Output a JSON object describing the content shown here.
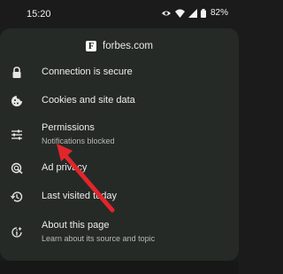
{
  "statusbar": {
    "time": "15:20",
    "icons": [
      "eye-icon",
      "wifi-icon",
      "signal-icon",
      "battery-icon"
    ],
    "battery": "82%"
  },
  "header": {
    "favicon_letter": "F",
    "site": "forbes.com"
  },
  "menu": {
    "items": [
      {
        "icon": "lock-icon",
        "title": "Connection is secure"
      },
      {
        "icon": "cookie-icon",
        "title": "Cookies and site data"
      },
      {
        "icon": "tune-icon",
        "title": "Permissions",
        "subtitle": "Notifications blocked"
      },
      {
        "icon": "ad-privacy-icon",
        "title": "Ad privacy"
      },
      {
        "icon": "history-icon",
        "title": "Last visited today"
      },
      {
        "icon": "info-icon",
        "title": "About this page",
        "subtitle": "Learn about its source and topic"
      }
    ]
  },
  "colors": {
    "sheet_bg": "#262a27",
    "page_bg": "#1b1b1b",
    "annotation_arrow": "#e0262b"
  }
}
